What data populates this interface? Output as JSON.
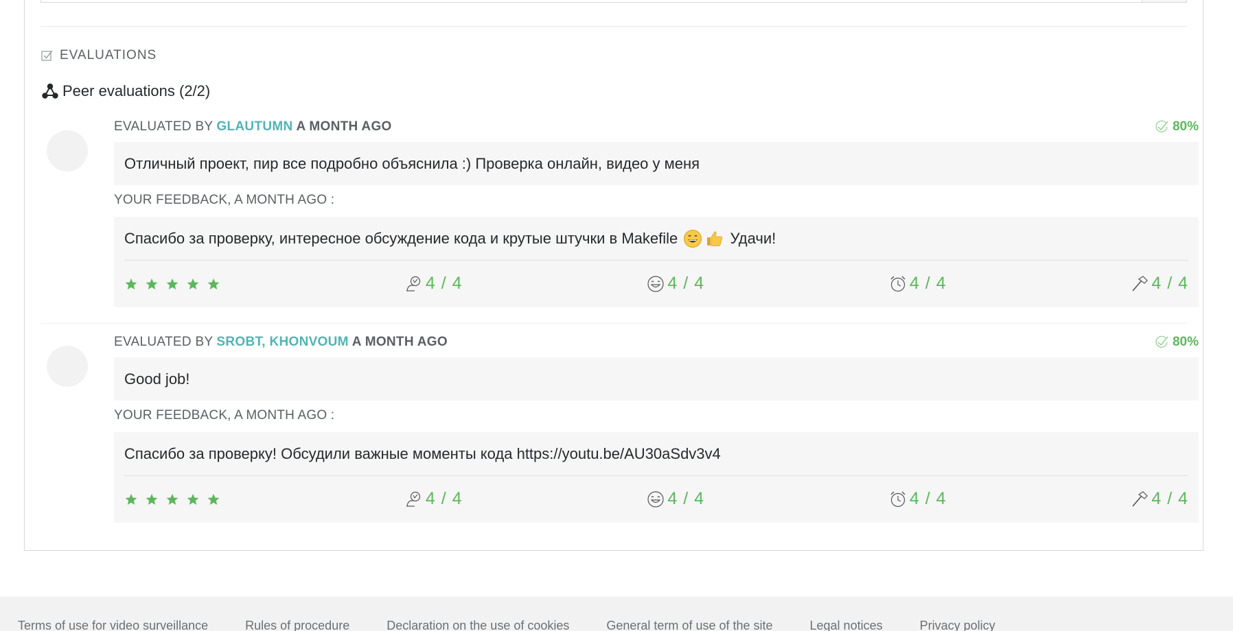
{
  "evaluations": {
    "section_title": "EVALUATIONS",
    "peer_title": "Peer evaluations (2/2)",
    "items": [
      {
        "by_label": "EVALUATED BY",
        "login": "GLAUTUMN",
        "when": "A MONTH AGO",
        "score": "80%",
        "comment": "Отличный проект, пир все подробно объяснила :) Проверка онлайн, видео у меня",
        "feedback_label": "YOUR FEEDBACK, A MONTH AGO :",
        "feedback_before": "Спасибо за проверку, интересное обсуждение кода и крутые штучки в Makefile",
        "feedback_emojis": [
          "grinning-face-emoji",
          "thumbs-up-emoji"
        ],
        "feedback_after": "Удачи!",
        "stars": 5,
        "ratings": [
          {
            "icon": "nice-icon",
            "value": "4 / 4"
          },
          {
            "icon": "smile-icon",
            "value": "4 / 4"
          },
          {
            "icon": "punctuality-clock-icon",
            "value": "4 / 4"
          },
          {
            "icon": "rigorous-hammer-icon",
            "value": "4 / 4"
          }
        ]
      },
      {
        "by_label": "EVALUATED BY",
        "login": "SROBT, KHONVOUM",
        "when": "A MONTH AGO",
        "score": "80%",
        "comment": "Good job!",
        "feedback_label": "YOUR FEEDBACK, A MONTH AGO :",
        "feedback_before": "Спасибо за проверку! Обсудили важные моменты кода https://youtu.be/AU30aSdv3v4",
        "feedback_emojis": [],
        "feedback_after": "",
        "stars": 5,
        "ratings": [
          {
            "icon": "nice-icon",
            "value": "4 / 4"
          },
          {
            "icon": "smile-icon",
            "value": "4 / 4"
          },
          {
            "icon": "punctuality-clock-icon",
            "value": "4 / 4"
          },
          {
            "icon": "rigorous-hammer-icon",
            "value": "4 / 4"
          }
        ]
      }
    ]
  },
  "footer": {
    "links": [
      "Terms of use for video surveillance",
      "Rules of procedure",
      "Declaration on the use of cookies",
      "General term of use of the site",
      "Legal notices",
      "Privacy policy"
    ]
  },
  "colors": {
    "accent_teal": "#4fb5b3",
    "success_green": "#5cb85c",
    "box_bg": "#f6f6f6",
    "footer_bg": "#f2f2f2"
  }
}
